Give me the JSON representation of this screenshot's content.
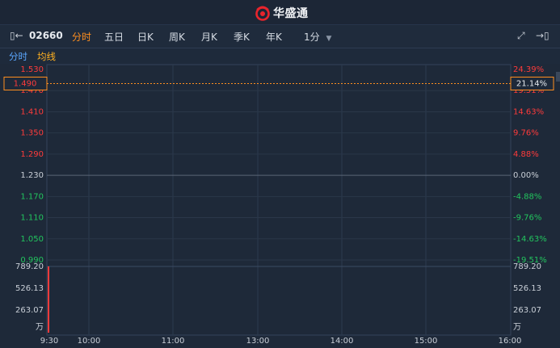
{
  "app": {
    "title": "华盛通"
  },
  "toolbar": {
    "stock_code": "02660",
    "periods": [
      "分时",
      "五日",
      "日K",
      "周K",
      "月K",
      "季K",
      "年K"
    ],
    "active_period": "分时",
    "interval": "1分"
  },
  "legend": {
    "timeshare": "分时",
    "avg_line": "均线"
  },
  "colors": {
    "up": "#ff3b3b",
    "down": "#22c55e",
    "neutral": "#c9cfd7",
    "accent": "#ff8f1f",
    "timeshare_legend": "#5ba7ff",
    "avg_legend": "#ffb020"
  },
  "chart_data": {
    "type": "line",
    "price_axis": {
      "left_labels": [
        "1.530",
        "1.470",
        "1.410",
        "1.350",
        "1.290",
        "1.230",
        "1.170",
        "1.110",
        "1.050",
        "0.990"
      ],
      "right_labels": [
        "24.39%",
        "19.51%",
        "14.63%",
        "9.76%",
        "4.88%",
        "0.00%",
        "-4.88%",
        "-9.76%",
        "-14.63%",
        "-19.51%"
      ],
      "ylim": [
        0.99,
        1.53
      ],
      "prev_close": 1.23
    },
    "current_price": {
      "value": "1.490",
      "change": "21.14%"
    },
    "volume_axis": {
      "left_labels": [
        "789.20",
        "526.13",
        "263.07",
        "万"
      ],
      "right_labels": [
        "789.20",
        "526.13",
        "263.07",
        "万"
      ],
      "max": 789.2
    },
    "x_axis": {
      "labels": [
        "9:30",
        "10:00",
        "11:00",
        "13:00",
        "14:00",
        "15:00",
        "16:00"
      ]
    },
    "volume_bars": [
      {
        "x": "9:30",
        "value": 789.2
      }
    ]
  }
}
